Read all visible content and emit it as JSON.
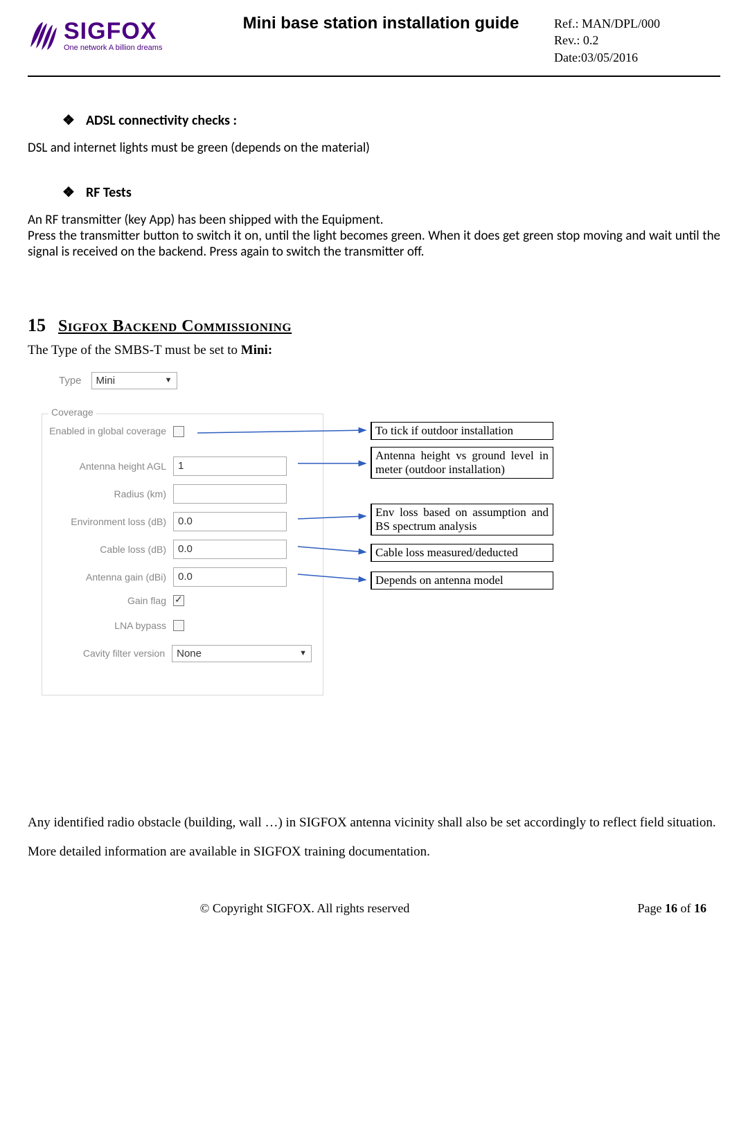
{
  "header": {
    "logo": {
      "name": "SIGFOX",
      "tagline": "One network A billion dreams"
    },
    "title": "Mini base station installation guide",
    "ref": "Ref.: MAN/DPL/000",
    "rev": "Rev.: 0.2",
    "date": "Date:03/05/2016"
  },
  "sections": {
    "adsl": {
      "heading": "ADSL connectivity checks :",
      "text": "DSL and internet lights must be green (depends on the material)"
    },
    "rf": {
      "heading": "RF Tests",
      "p1": "An RF transmitter (key App) has been shipped with the Equipment.",
      "p2": "Press the transmitter button to switch it on, until the light becomes green. When it does get green stop moving and wait until the signal is received on the backend. Press again to switch the transmitter off."
    },
    "commissioning": {
      "num": "15",
      "heading": "Sigfox Backend Commissioning",
      "intro_pre": "The Type of the SMBS-T must be set to ",
      "intro_bold": "Mini:"
    },
    "after_form": {
      "p1": "Any identified radio obstacle (building, wall …) in SIGFOX antenna vicinity shall also be set accordingly to reflect field situation.",
      "p2": "More detailed information are available in SIGFOX training documentation."
    }
  },
  "form": {
    "type_label": "Type",
    "type_value": "Mini",
    "coverage_legend": "Coverage",
    "rows": {
      "enabled": {
        "label": "Enabled in global coverage",
        "checked": false
      },
      "height": {
        "label": "Antenna height AGL",
        "value": "1"
      },
      "radius": {
        "label": "Radius (km)",
        "value": ""
      },
      "envloss": {
        "label": "Environment loss (dB)",
        "value": "0.0"
      },
      "cabloss": {
        "label": "Cable loss (dB)",
        "value": "0.0"
      },
      "gain": {
        "label": "Antenna gain (dBi)",
        "value": "0.0"
      },
      "gainflag": {
        "label": "Gain flag",
        "checked": true
      },
      "lna": {
        "label": "LNA bypass",
        "checked": false
      },
      "cavity": {
        "label": "Cavity filter version",
        "value": "None"
      }
    },
    "callouts": {
      "c1": "To tick if outdoor installation",
      "c2": "Antenna height vs ground level in meter (outdoor installation)",
      "c3": "Env loss based on assumption and BS spectrum analysis",
      "c4": "Cable loss measured/deducted",
      "c5": "Depends on antenna model"
    }
  },
  "footer": {
    "copyright": "© Copyright SIGFOX. All rights reserved",
    "page_prefix": "Page ",
    "page_cur": "16",
    "page_of": " of ",
    "page_total": "16"
  }
}
